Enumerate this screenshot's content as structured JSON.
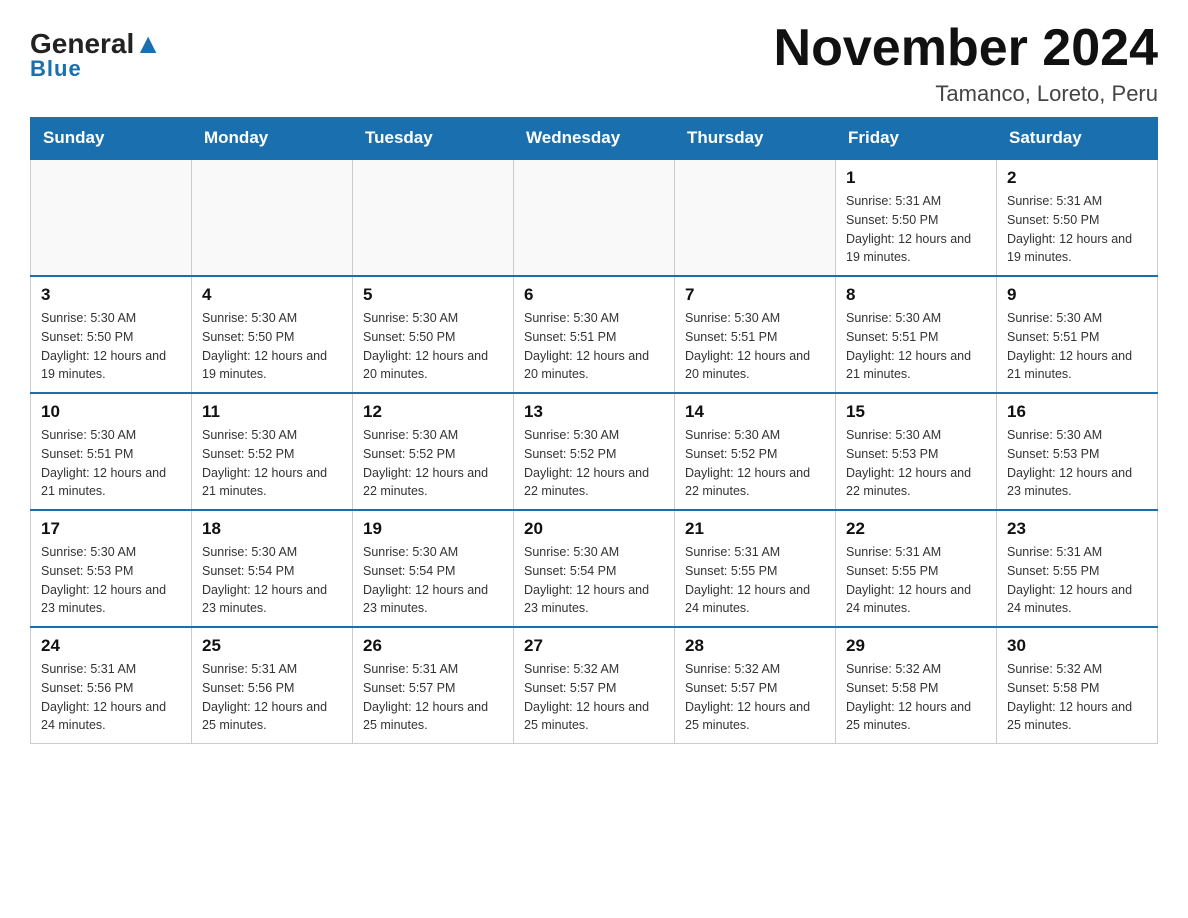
{
  "header": {
    "logo_general": "General",
    "logo_blue": "Blue",
    "month_title": "November 2024",
    "location": "Tamanco, Loreto, Peru"
  },
  "weekdays": [
    "Sunday",
    "Monday",
    "Tuesday",
    "Wednesday",
    "Thursday",
    "Friday",
    "Saturday"
  ],
  "weeks": [
    [
      {
        "day": "",
        "info": ""
      },
      {
        "day": "",
        "info": ""
      },
      {
        "day": "",
        "info": ""
      },
      {
        "day": "",
        "info": ""
      },
      {
        "day": "",
        "info": ""
      },
      {
        "day": "1",
        "info": "Sunrise: 5:31 AM\nSunset: 5:50 PM\nDaylight: 12 hours and 19 minutes."
      },
      {
        "day": "2",
        "info": "Sunrise: 5:31 AM\nSunset: 5:50 PM\nDaylight: 12 hours and 19 minutes."
      }
    ],
    [
      {
        "day": "3",
        "info": "Sunrise: 5:30 AM\nSunset: 5:50 PM\nDaylight: 12 hours and 19 minutes."
      },
      {
        "day": "4",
        "info": "Sunrise: 5:30 AM\nSunset: 5:50 PM\nDaylight: 12 hours and 19 minutes."
      },
      {
        "day": "5",
        "info": "Sunrise: 5:30 AM\nSunset: 5:50 PM\nDaylight: 12 hours and 20 minutes."
      },
      {
        "day": "6",
        "info": "Sunrise: 5:30 AM\nSunset: 5:51 PM\nDaylight: 12 hours and 20 minutes."
      },
      {
        "day": "7",
        "info": "Sunrise: 5:30 AM\nSunset: 5:51 PM\nDaylight: 12 hours and 20 minutes."
      },
      {
        "day": "8",
        "info": "Sunrise: 5:30 AM\nSunset: 5:51 PM\nDaylight: 12 hours and 21 minutes."
      },
      {
        "day": "9",
        "info": "Sunrise: 5:30 AM\nSunset: 5:51 PM\nDaylight: 12 hours and 21 minutes."
      }
    ],
    [
      {
        "day": "10",
        "info": "Sunrise: 5:30 AM\nSunset: 5:51 PM\nDaylight: 12 hours and 21 minutes."
      },
      {
        "day": "11",
        "info": "Sunrise: 5:30 AM\nSunset: 5:52 PM\nDaylight: 12 hours and 21 minutes."
      },
      {
        "day": "12",
        "info": "Sunrise: 5:30 AM\nSunset: 5:52 PM\nDaylight: 12 hours and 22 minutes."
      },
      {
        "day": "13",
        "info": "Sunrise: 5:30 AM\nSunset: 5:52 PM\nDaylight: 12 hours and 22 minutes."
      },
      {
        "day": "14",
        "info": "Sunrise: 5:30 AM\nSunset: 5:52 PM\nDaylight: 12 hours and 22 minutes."
      },
      {
        "day": "15",
        "info": "Sunrise: 5:30 AM\nSunset: 5:53 PM\nDaylight: 12 hours and 22 minutes."
      },
      {
        "day": "16",
        "info": "Sunrise: 5:30 AM\nSunset: 5:53 PM\nDaylight: 12 hours and 23 minutes."
      }
    ],
    [
      {
        "day": "17",
        "info": "Sunrise: 5:30 AM\nSunset: 5:53 PM\nDaylight: 12 hours and 23 minutes."
      },
      {
        "day": "18",
        "info": "Sunrise: 5:30 AM\nSunset: 5:54 PM\nDaylight: 12 hours and 23 minutes."
      },
      {
        "day": "19",
        "info": "Sunrise: 5:30 AM\nSunset: 5:54 PM\nDaylight: 12 hours and 23 minutes."
      },
      {
        "day": "20",
        "info": "Sunrise: 5:30 AM\nSunset: 5:54 PM\nDaylight: 12 hours and 23 minutes."
      },
      {
        "day": "21",
        "info": "Sunrise: 5:31 AM\nSunset: 5:55 PM\nDaylight: 12 hours and 24 minutes."
      },
      {
        "day": "22",
        "info": "Sunrise: 5:31 AM\nSunset: 5:55 PM\nDaylight: 12 hours and 24 minutes."
      },
      {
        "day": "23",
        "info": "Sunrise: 5:31 AM\nSunset: 5:55 PM\nDaylight: 12 hours and 24 minutes."
      }
    ],
    [
      {
        "day": "24",
        "info": "Sunrise: 5:31 AM\nSunset: 5:56 PM\nDaylight: 12 hours and 24 minutes."
      },
      {
        "day": "25",
        "info": "Sunrise: 5:31 AM\nSunset: 5:56 PM\nDaylight: 12 hours and 25 minutes."
      },
      {
        "day": "26",
        "info": "Sunrise: 5:31 AM\nSunset: 5:57 PM\nDaylight: 12 hours and 25 minutes."
      },
      {
        "day": "27",
        "info": "Sunrise: 5:32 AM\nSunset: 5:57 PM\nDaylight: 12 hours and 25 minutes."
      },
      {
        "day": "28",
        "info": "Sunrise: 5:32 AM\nSunset: 5:57 PM\nDaylight: 12 hours and 25 minutes."
      },
      {
        "day": "29",
        "info": "Sunrise: 5:32 AM\nSunset: 5:58 PM\nDaylight: 12 hours and 25 minutes."
      },
      {
        "day": "30",
        "info": "Sunrise: 5:32 AM\nSunset: 5:58 PM\nDaylight: 12 hours and 25 minutes."
      }
    ]
  ]
}
